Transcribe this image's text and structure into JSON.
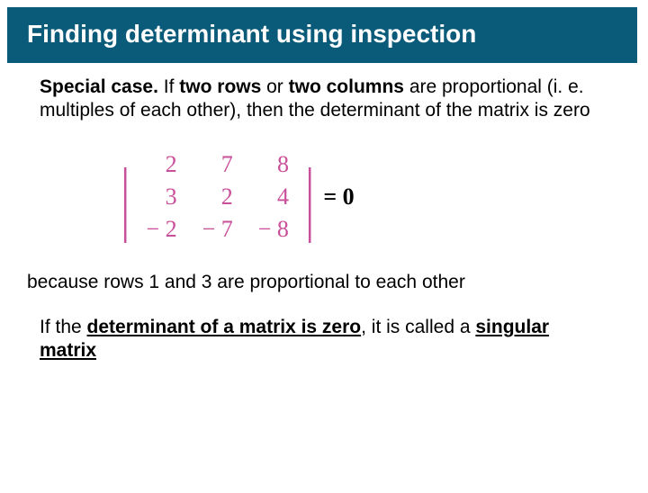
{
  "title": "Finding determinant using inspection",
  "para1_a": "Special case.",
  "para1_b": " If ",
  "para1_c": "two rows",
  "para1_d": " or ",
  "para1_e": "two columns",
  "para1_f": " are proportional (i. e. multiples of each other), then the determinant of the matrix is zero",
  "m": {
    "r1c1": "2",
    "r1c2": "7",
    "r1c3": "8",
    "r2c1": "3",
    "r2c2": "2",
    "r2c3": "4",
    "r3c1": "− 2",
    "r3c2": "− 7",
    "r3c3": "− 8"
  },
  "equals": "= 0",
  "conclusion": "because rows 1 and 3 are proportional to each other",
  "final_a": "If the ",
  "final_b": "determinant of a matrix is zero",
  "final_c": ", it is called a ",
  "final_d": "singular matrix",
  "chart_data": {
    "type": "table",
    "title": "3x3 determinant equals zero (rows 1 and 3 proportional)",
    "rows": [
      [
        2,
        7,
        8
      ],
      [
        3,
        2,
        4
      ],
      [
        -2,
        -7,
        -8
      ]
    ],
    "result": 0
  }
}
